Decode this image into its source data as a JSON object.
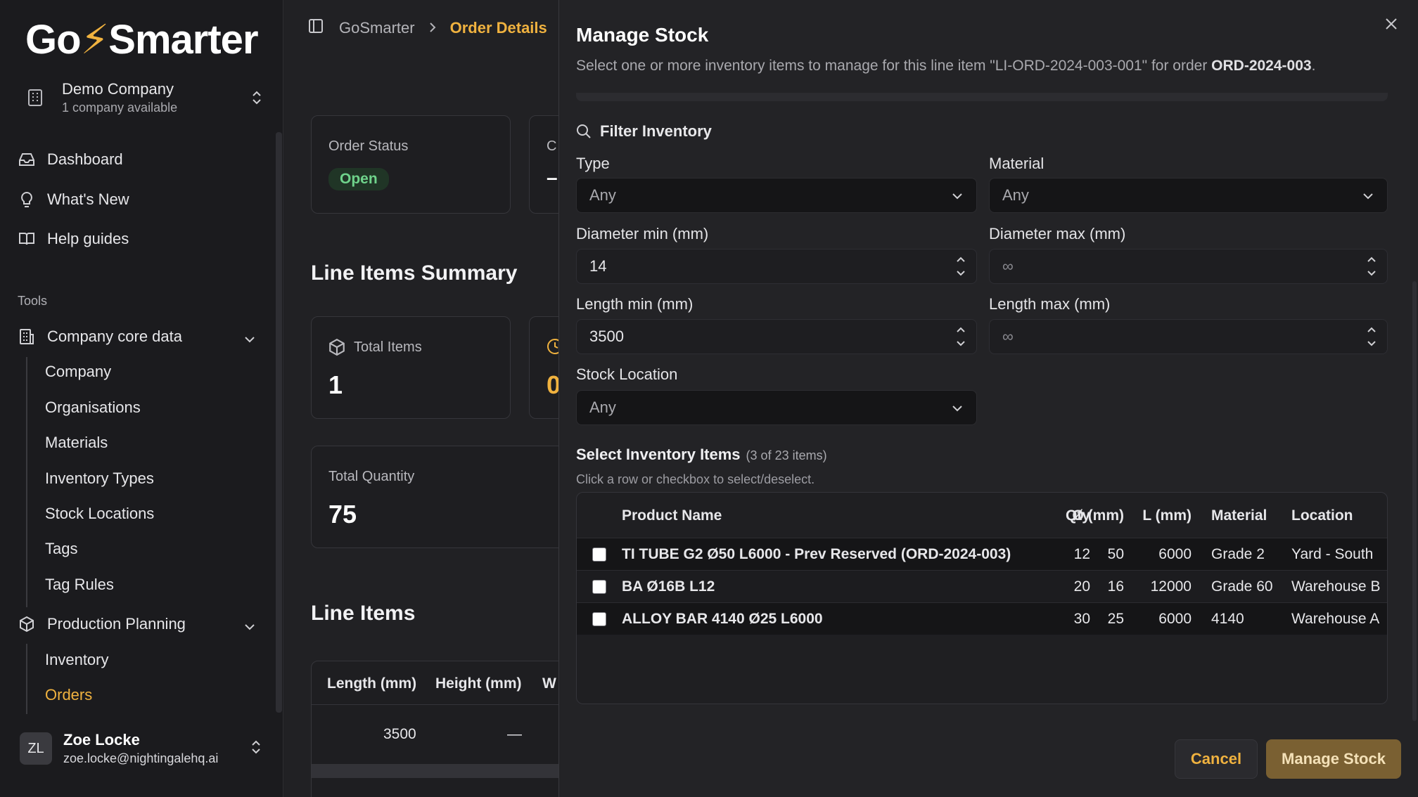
{
  "sidebar": {
    "logo_prefix": "Go",
    "logo_bolt": "⚡",
    "logo_suffix": "Smarter",
    "company": {
      "name": "Demo Company",
      "sub": "1 company available"
    },
    "nav": [
      {
        "label": "Dashboard",
        "icon": "inbox-icon"
      },
      {
        "label": "What's New",
        "icon": "lightbulb-icon"
      },
      {
        "label": "Help guides",
        "icon": "book-icon"
      }
    ],
    "tools_label": "Tools",
    "core_data": {
      "label": "Company core data",
      "items": [
        "Company",
        "Organisations",
        "Materials",
        "Inventory Types",
        "Stock Locations",
        "Tags",
        "Tag Rules"
      ]
    },
    "production": {
      "label": "Production Planning",
      "items": [
        "Inventory",
        "Orders"
      ],
      "active": "Orders"
    },
    "user": {
      "initials": "ZL",
      "name": "Zoe Locke",
      "email": "zoe.locke@nightingalehq.ai"
    }
  },
  "main": {
    "breadcrumb": {
      "home": "GoSmarter",
      "current": "Order Details"
    },
    "order_status": {
      "label": "Order Status",
      "value": "Open"
    },
    "second_card_partial": {
      "label": "C",
      "value": "–"
    },
    "line_items_summary": "Line Items Summary",
    "total_items": {
      "label": "Total Items",
      "value": "1"
    },
    "third_card_partial": "0",
    "total_quantity": {
      "label": "Total Quantity",
      "value": "75"
    },
    "line_items": "Line Items",
    "table": {
      "headers": [
        "Length (mm)",
        "Height (mm)",
        "W"
      ],
      "row": [
        "3500",
        "—"
      ]
    }
  },
  "modal": {
    "title": "Manage Stock",
    "desc_prefix": "Select one or more inventory items to manage for this line item \"LI-ORD-2024-003-001\" for order ",
    "desc_order": "ORD-2024-003",
    "desc_suffix": ".",
    "filter_heading": "Filter Inventory",
    "type": {
      "label": "Type",
      "value": "Any"
    },
    "material": {
      "label": "Material",
      "value": "Any"
    },
    "dia_min": {
      "label": "Diameter min (mm)",
      "value": "14"
    },
    "dia_max": {
      "label": "Diameter max (mm)",
      "value": "∞"
    },
    "len_min": {
      "label": "Length min (mm)",
      "value": "3500"
    },
    "len_max": {
      "label": "Length max (mm)",
      "value": "∞"
    },
    "location": {
      "label": "Stock Location",
      "value": "Any"
    },
    "select_heading": "Select Inventory Items",
    "select_count": "(3 of 23 items)",
    "select_hint": "Click a row or checkbox to select/deselect.",
    "columns": [
      "Product Name",
      "Qty",
      "Ø (mm)",
      "L (mm)",
      "Material",
      "Location"
    ],
    "rows": [
      [
        "TI TUBE G2 Ø50 L6000 - Prev Reserved (ORD-2024-003)",
        "12",
        "50",
        "6000",
        "Grade 2",
        "Yard - South"
      ],
      [
        "BA Ø16B L12",
        "20",
        "16",
        "12000",
        "Grade 60",
        "Warehouse B"
      ],
      [
        "ALLOY BAR 4140 Ø25 L6000",
        "30",
        "25",
        "6000",
        "4140",
        "Warehouse A"
      ]
    ],
    "cancel": "Cancel",
    "submit": "Manage Stock"
  },
  "colors": {
    "accent": "#f0b23f",
    "success": "#6fd38b",
    "primary_button": "#7a6032"
  }
}
